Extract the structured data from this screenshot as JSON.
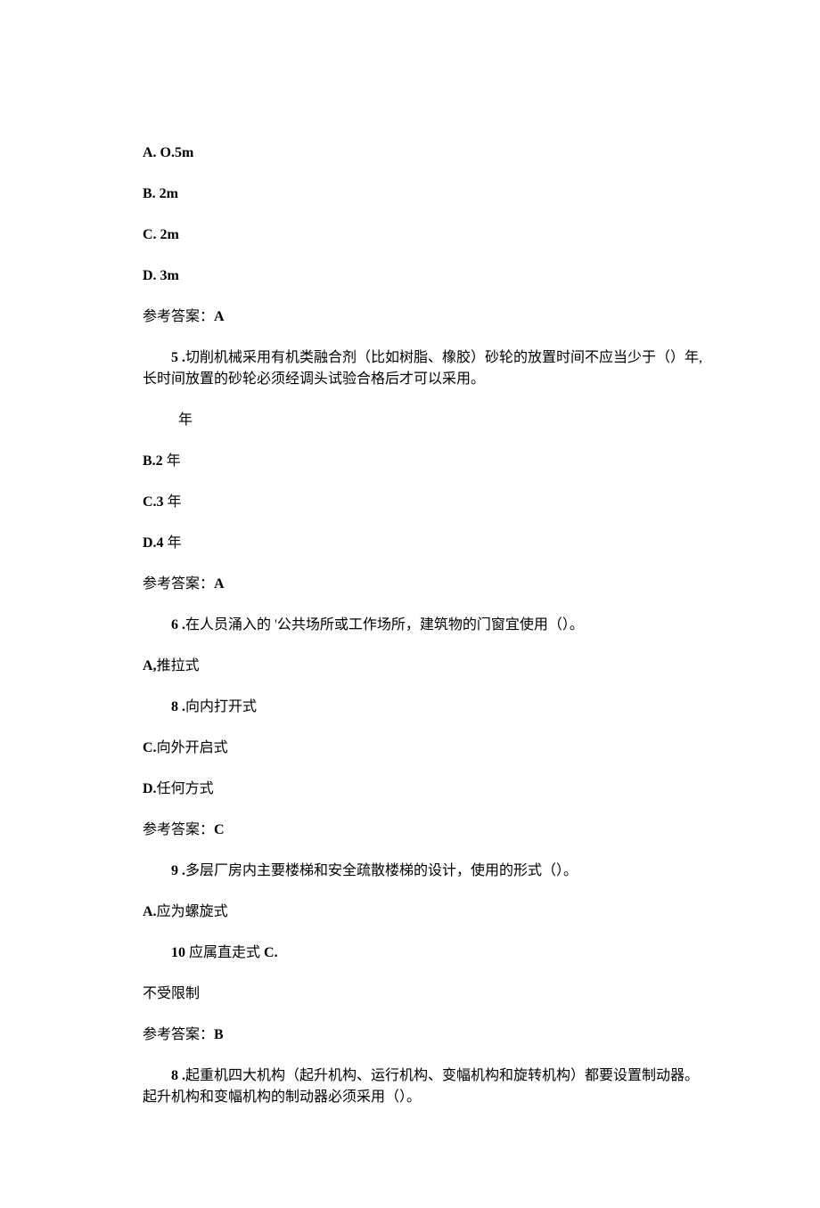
{
  "q4": {
    "optA": "A.  O.5m",
    "optB": "B.  2m",
    "optC": "C.  2m",
    "optD": "D.  3m",
    "ansLabel": "参考答案：",
    "ans": "A"
  },
  "q5": {
    "numLabel": "5  .",
    "text1": "切削机械采用有机类融合剂（比如树脂、橡胶）砂轮的放置时间不应当少于（）年, 长时间放置的砂轮必须经调头试验合格后才可以采用。",
    "optA": "年",
    "optBLabel": "B.2",
    "optBUnit": " 年",
    "optCLabel": "C.3",
    "optCUnit": " 年",
    "optDLabel": "D.4",
    "optDUnit": " 年",
    "ansLabel": "参考答案：",
    "ans": "A"
  },
  "q6": {
    "numLabel": "6  .",
    "text": "在人员涌入的 '公共场所或工作场所，建筑物的门窗宜使用（）。",
    "optALabel": "A,",
    "optAText": "推拉式",
    "optBLabel": "8  .",
    "optBText": "向内打开式",
    "optCLabel": "C.",
    "optCText": "向外开启式",
    "optDLabel": "D.",
    "optDText": "任何方式",
    "ansLabel": "参考答案：",
    "ans": "C"
  },
  "q7": {
    "numLabel": "9  .",
    "text": "多层厂房内主要楼梯和安全疏散楼梯的设计，使用的形式（）。",
    "optALabel": "A.",
    "optAText": "应为螺旋式",
    "optBLabel": "10",
    "optBText": "  应属直走式 ",
    "optBTrail": "C.",
    "optCText": "不受限制",
    "ansLabel": "参考答案：",
    "ans": "B"
  },
  "q8": {
    "numLabel": "8  .",
    "text": "起重机四大机构（起升机构、运行机构、变幅机构和旋转机构）都要设置制动器。起升机构和变幅机构的制动器必须采用（）。"
  }
}
